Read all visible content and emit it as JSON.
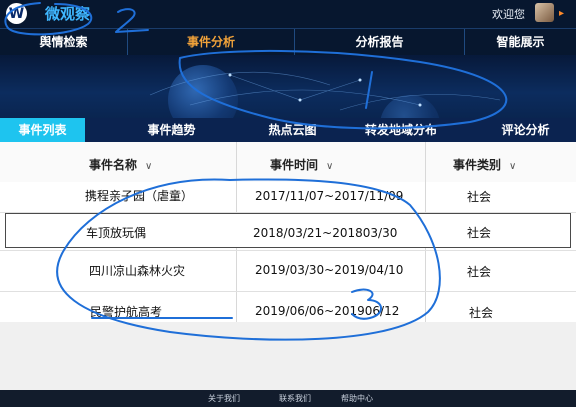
{
  "header": {
    "logo_text": "微观察",
    "welcome": "欢迎您"
  },
  "nav": {
    "items": [
      {
        "label": "舆情检索"
      },
      {
        "label": "事件分析"
      },
      {
        "label": "分析报告"
      },
      {
        "label": "智能展示"
      }
    ],
    "active": 1
  },
  "subtabs": {
    "items": [
      {
        "label": "事件列表"
      },
      {
        "label": "事件趋势"
      },
      {
        "label": "热点云图"
      },
      {
        "label": "转发地域分布"
      },
      {
        "label": "评论分析"
      }
    ],
    "active": 0
  },
  "table": {
    "columns": [
      "事件名称",
      "事件时间",
      "事件类别"
    ],
    "rows": [
      {
        "name": "携程亲子园（虐童）",
        "time": "2017/11/07~2017/11/09",
        "category": "社会"
      },
      {
        "name": "车顶放玩偶",
        "time": "2018/03/21~201803/30",
        "category": "社会"
      },
      {
        "name": "四川凉山森林火灾",
        "time": "2019/03/30~2019/04/10",
        "category": "社会"
      },
      {
        "name": "民警护航高考",
        "time": "2019/06/06~201906/12",
        "category": "社会"
      }
    ],
    "selected_row": 1
  },
  "footer": {
    "links": [
      "关于我们",
      "联系我们",
      "帮助中心"
    ]
  },
  "colors": {
    "dark_bg": "#07172f",
    "accent_cyan": "#1ec4ef",
    "active_nav": "#f0a23a",
    "annotation_ink": "#1f6fd8"
  }
}
